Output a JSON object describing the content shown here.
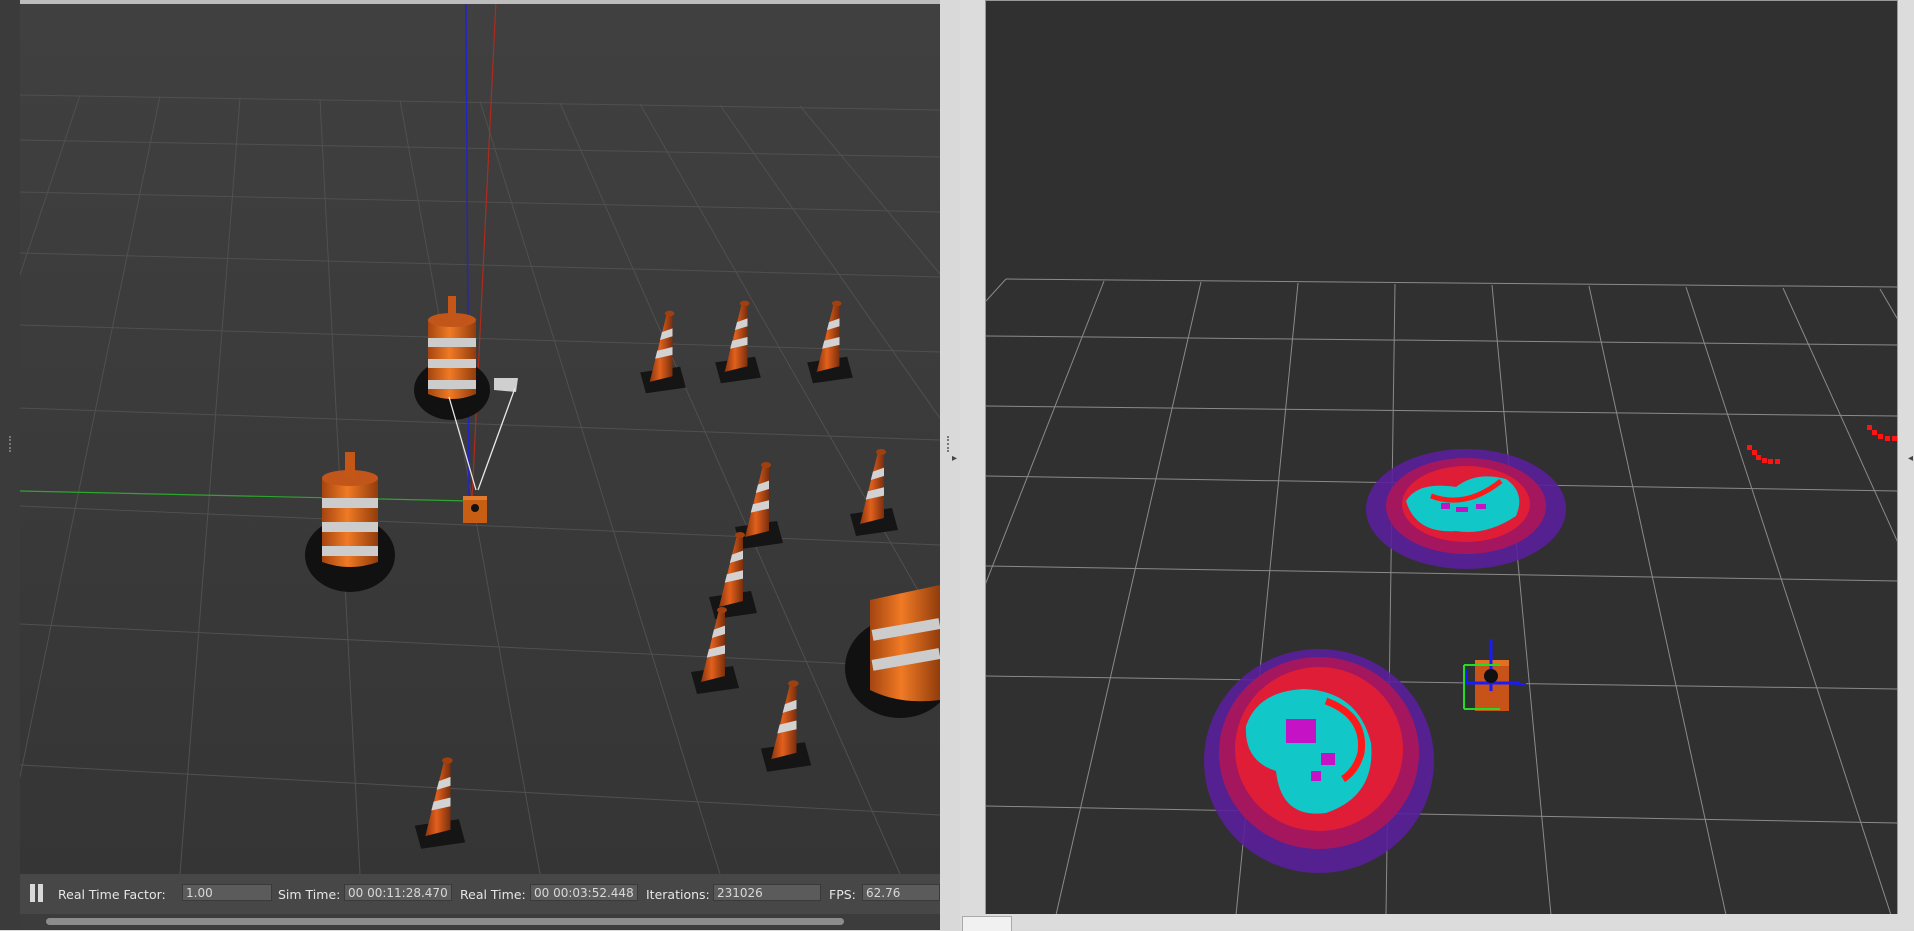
{
  "gazebo": {
    "status_bar": {
      "real_time_factor_label": "Real Time Factor:",
      "real_time_factor_value": "1.00",
      "sim_time_label": "Sim Time:",
      "sim_time_value": "00 00:11:28.470",
      "real_time_label": "Real Time:",
      "real_time_value": "00 00:03:52.448",
      "iterations_label": "Iterations:",
      "iterations_value": "231026",
      "fps_label": "FPS:",
      "fps_value": "62.76"
    },
    "pause_icon": "pause-icon"
  },
  "rviz": {
    "scene": "costmap-grid-view"
  },
  "colors": {
    "grid_line": "#777777",
    "costmap_cyan": "#11c7c7",
    "costmap_magenta": "#c412c4",
    "laser_red": "#ff0000",
    "axis_blue": "#1e1ed2",
    "axis_green": "#22bb22",
    "cone_orange": "#e0601a"
  }
}
